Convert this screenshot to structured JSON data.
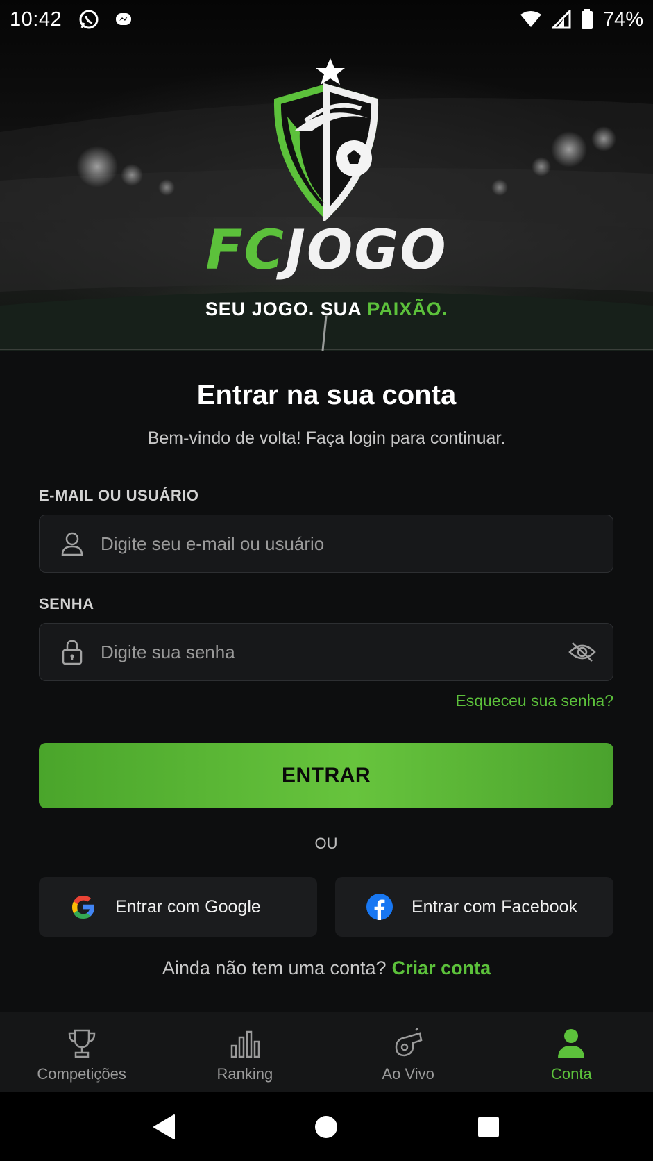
{
  "status_bar": {
    "time": "10:42",
    "battery": "74%",
    "icons": [
      "whatsapp-icon",
      "messenger-icon",
      "wifi-icon",
      "signal-icon",
      "battery-icon"
    ]
  },
  "hero": {
    "brand_primary": "FC",
    "brand_secondary": "JOGO",
    "tagline_start": "SEU JOGO. SUA ",
    "tagline_accent": "PAIXÃO."
  },
  "login": {
    "title": "Entrar na sua conta",
    "subtitle": "Bem-vindo de volta! Faça login para continuar.",
    "email": {
      "label": "E-MAIL OU USUÁRIO",
      "placeholder": "Digite seu e-mail ou usuário",
      "value": ""
    },
    "password": {
      "label": "SENHA",
      "placeholder": "Digite sua senha",
      "value": ""
    },
    "forgot_password": "Esqueceu sua senha?",
    "submit_label": "ENTRAR",
    "divider": "OU",
    "google_label": "Entrar com Google",
    "facebook_label": "Entrar com Facebook",
    "signup_prompt": "Ainda não tem uma conta?",
    "signup_link": "Criar conta"
  },
  "bottom_nav": {
    "items": [
      {
        "label": "Competições",
        "icon": "trophy-icon",
        "active": false
      },
      {
        "label": "Ranking",
        "icon": "bar-chart-icon",
        "active": false
      },
      {
        "label": "Ao Vivo",
        "icon": "whistle-icon",
        "active": false
      },
      {
        "label": "Conta",
        "icon": "user-icon",
        "active": true
      }
    ]
  },
  "colors": {
    "accent": "#5cc13b",
    "background": "#0d0e0f",
    "input_background": "#17181a",
    "nav_background": "#151617"
  }
}
